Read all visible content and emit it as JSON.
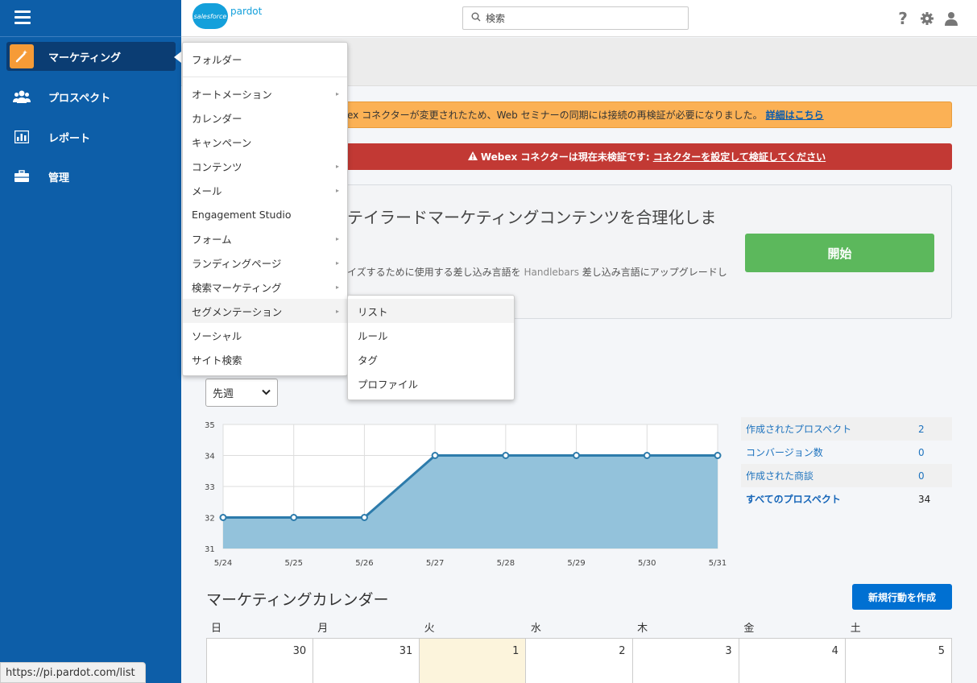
{
  "sidebar": {
    "items": [
      {
        "label": "マーケティング",
        "icon": "wand-icon"
      },
      {
        "label": "プロスペクト",
        "icon": "people-icon"
      },
      {
        "label": "レポート",
        "icon": "report-icon"
      },
      {
        "label": "管理",
        "icon": "briefcase-icon"
      }
    ]
  },
  "header": {
    "logo_brand": "salesforce",
    "logo_product": "pardot",
    "search_placeholder": "検索",
    "help_glyph": "?"
  },
  "alerts": {
    "warning_text": "ex コネクターが変更されたため、Web セミナーの同期には接続の再検証が必要になりました。",
    "warning_link": "詳細はこちら",
    "error_text": "Webex コネクターは現在未検証です:",
    "error_link": "コネクターを設定して検証してください",
    "error_icon": "warning-triangle-icon"
  },
  "promo": {
    "title": "テイラードマーケティングコンテンツを合理化しま",
    "body_pre": "イズするために使用する差し込み言語を ",
    "body_muted": "Handlebars",
    "body_post": " 差し込み言語にアップグレードし",
    "button": "開始"
  },
  "period_select": {
    "value": "先週"
  },
  "chart_data": {
    "type": "area",
    "x": [
      "5/24",
      "5/25",
      "5/26",
      "5/27",
      "5/28",
      "5/29",
      "5/30",
      "5/31"
    ],
    "y_ticks": [
      "35",
      "34",
      "33",
      "32",
      "31"
    ],
    "series": [
      {
        "values": [
          32,
          32,
          32,
          34,
          34,
          34,
          34,
          34
        ]
      }
    ],
    "ylim": [
      31,
      35
    ],
    "grid": true,
    "colors": {
      "line": "#2d7bab",
      "fill": "#93c2db",
      "grid": "#dddddd"
    }
  },
  "stats": [
    {
      "label": "作成されたプロスペクト",
      "value": "2"
    },
    {
      "label": "コンバージョン数",
      "value": "0"
    },
    {
      "label": "作成された商談",
      "value": "0"
    },
    {
      "label": "すべてのプロスペクト",
      "value": "34"
    }
  ],
  "calendar": {
    "title": "マーケティングカレンダー",
    "new_button": "新規行動を作成",
    "weekdays": [
      "日",
      "月",
      "火",
      "水",
      "木",
      "金",
      "土"
    ],
    "dates": [
      "30",
      "31",
      "1",
      "2",
      "3",
      "4",
      "5"
    ]
  },
  "menu": {
    "items": [
      {
        "label": "フォルダー",
        "has_sub": false
      },
      {
        "label": "オートメーション",
        "has_sub": true
      },
      {
        "label": "カレンダー",
        "has_sub": false
      },
      {
        "label": "キャンペーン",
        "has_sub": false
      },
      {
        "label": "コンテンツ",
        "has_sub": true
      },
      {
        "label": "メール",
        "has_sub": true
      },
      {
        "label": "Engagement Studio",
        "has_sub": false
      },
      {
        "label": "フォーム",
        "has_sub": true
      },
      {
        "label": "ランディングページ",
        "has_sub": true
      },
      {
        "label": "検索マーケティング",
        "has_sub": true
      },
      {
        "label": "セグメンテーション",
        "has_sub": true
      },
      {
        "label": "ソーシャル",
        "has_sub": false
      },
      {
        "label": "サイト検索",
        "has_sub": false
      }
    ],
    "submenu": [
      "リスト",
      "ルール",
      "タグ",
      "プロファイル"
    ],
    "arrow_glyph": "▸"
  },
  "statusbar": {
    "url": "https://pi.pardot.com/list"
  }
}
